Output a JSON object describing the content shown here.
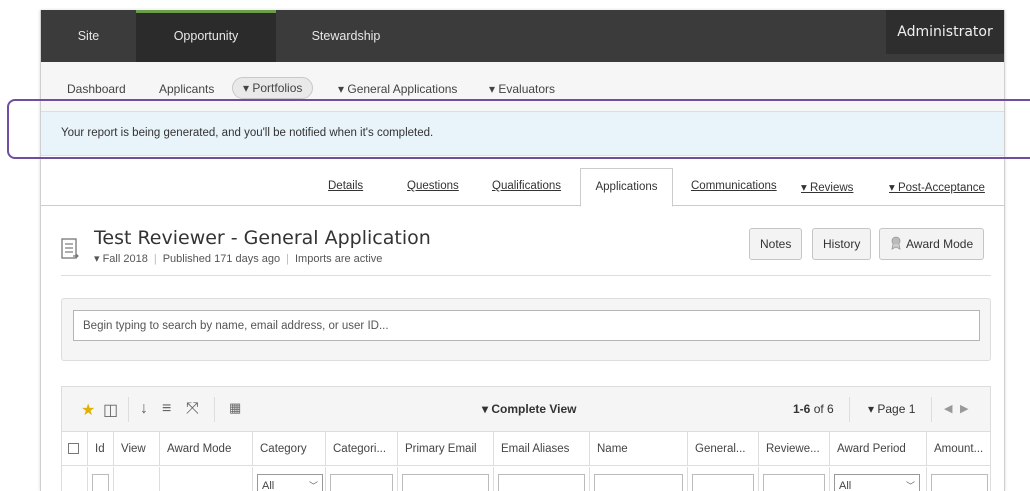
{
  "top_nav": {
    "items": [
      "Site",
      "Opportunity",
      "Stewardship"
    ],
    "active": "Opportunity",
    "user_label": "Administrator",
    "active_accent_color": "#6b9e4a"
  },
  "sub_nav": {
    "dashboard": "Dashboard",
    "applicants": "Applicants",
    "portfolios": "▾ Portfolios",
    "general_applications": "▾ General Applications",
    "evaluators": "▾ Evaluators"
  },
  "notification": {
    "message": "Your report is being generated, and you'll be notified when it's completed.",
    "highlight_color": "#6f4ea0"
  },
  "tabs": {
    "details": "Details",
    "questions": "Questions",
    "qualifications": "Qualifications",
    "applications": "Applications",
    "communications": "Communications",
    "reviews": "▾ Reviews",
    "post_acceptance": "▾ Post-Acceptance",
    "active": "Applications"
  },
  "header": {
    "title": "Test Reviewer - General Application",
    "term": "▾ Fall 2018",
    "published": "Published 171 days ago",
    "imports": "Imports are active",
    "notes_button": "Notes",
    "history_button": "History",
    "award_mode_button": "Award Mode",
    "award_mode_icon": "award-ribbon-icon",
    "doc_icon": "document-list-icon"
  },
  "search": {
    "placeholder": "Begin typing to search by name, email address, or user ID..."
  },
  "grid_toolbar": {
    "view_label": "▾ Complete View",
    "range": "1-6",
    "total": "of 6",
    "page_label": "▾ Page 1",
    "prev": "◀",
    "next": "▶",
    "icons": [
      "star-icon",
      "panel-toggle-icon",
      "sort-down-icon",
      "list-icon",
      "expand-icon",
      "add-column-icon"
    ]
  },
  "table": {
    "columns": [
      "Id",
      "View",
      "Award Mode",
      "Category",
      "Categori...",
      "Primary Email",
      "Email Aliases",
      "Name",
      "General...",
      "Reviewe...",
      "Award Period",
      "Amount..."
    ],
    "category_filter": "All",
    "award_period_filter": "All"
  }
}
